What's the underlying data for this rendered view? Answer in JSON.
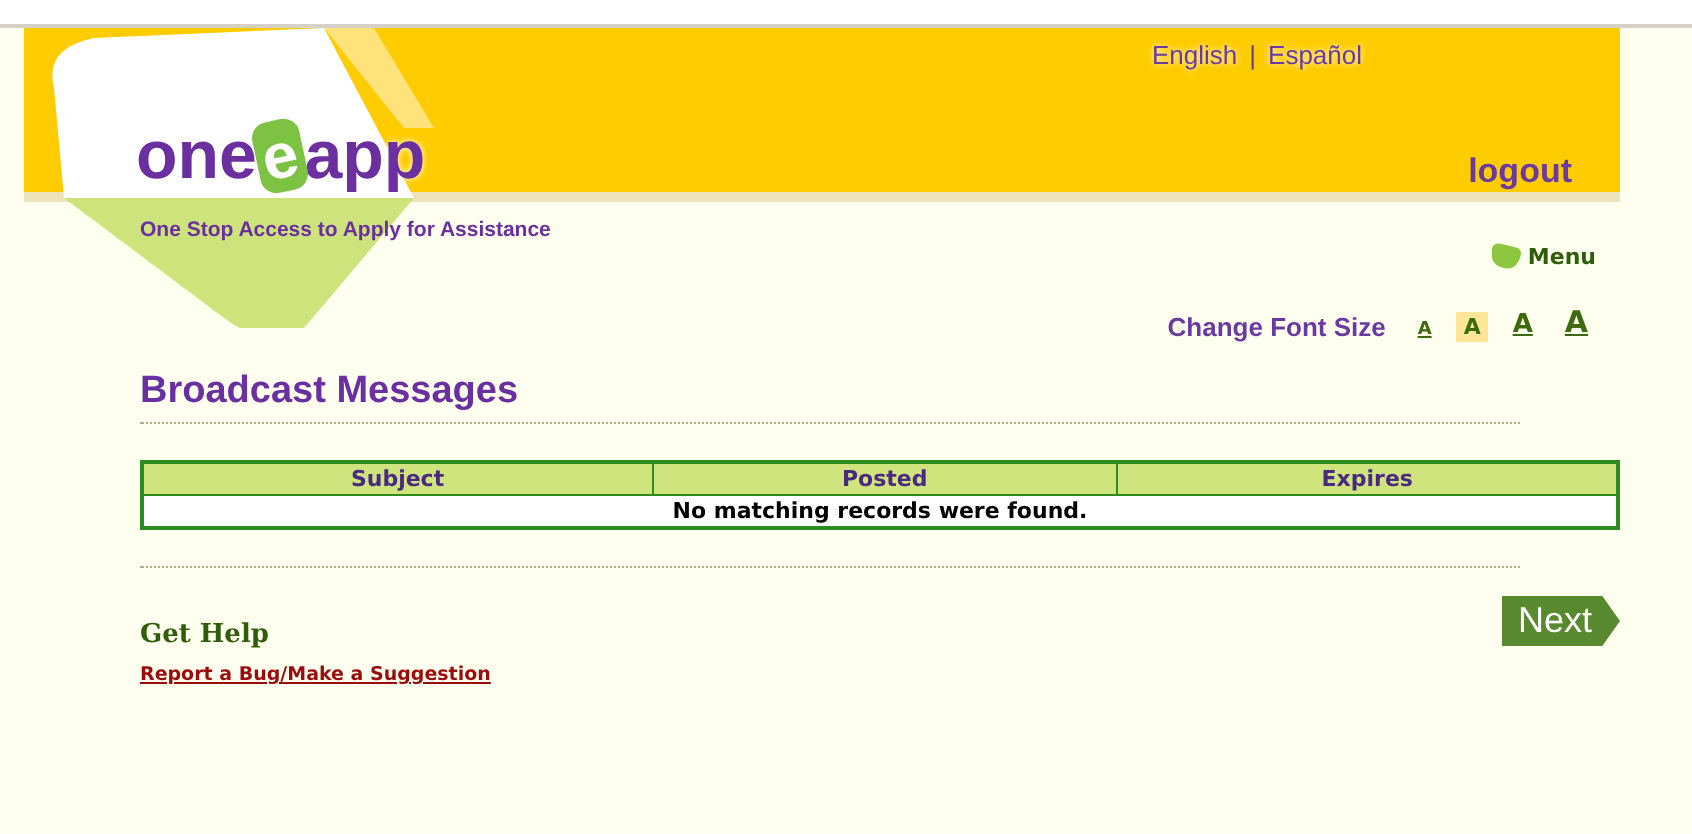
{
  "header": {
    "languages": [
      "English",
      "Español"
    ],
    "separator": "|",
    "logo": {
      "parts": [
        "one",
        "e",
        "app"
      ],
      "tagline": "One Stop Access to Apply for Assistance"
    },
    "logout": "logout"
  },
  "menu": {
    "label": "Menu"
  },
  "font_size": {
    "label": "Change Font Size",
    "options": [
      {
        "label": "A",
        "selected": false
      },
      {
        "label": "A",
        "selected": true
      },
      {
        "label": "A",
        "selected": false
      },
      {
        "label": "A",
        "selected": false
      }
    ]
  },
  "page_title": "Broadcast Messages",
  "table": {
    "columns": [
      "Subject",
      "Posted",
      "Expires"
    ],
    "empty_message": "No matching records were found."
  },
  "help": {
    "title": "Get Help",
    "link": "Report a Bug/Make a Suggestion"
  },
  "next_button": "Next"
}
